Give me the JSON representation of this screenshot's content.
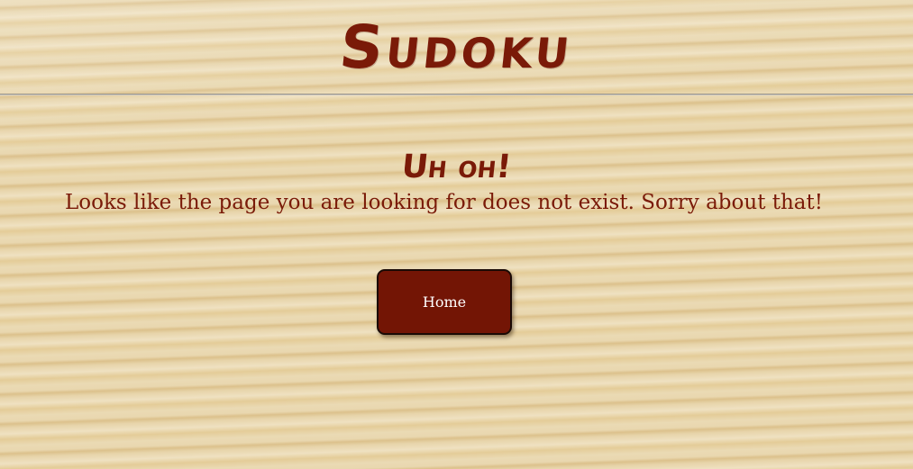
{
  "header": {
    "title": "Sudoku"
  },
  "error": {
    "heading": "Uh oh!",
    "message": "Looks like the page you are looking for does not exist. Sorry about that!"
  },
  "actions": {
    "home_label": "Home"
  },
  "colors": {
    "accent": "#7a1a08",
    "button_bg": "#731505",
    "button_text": "#ffffff",
    "background": "#e6d3a7"
  }
}
